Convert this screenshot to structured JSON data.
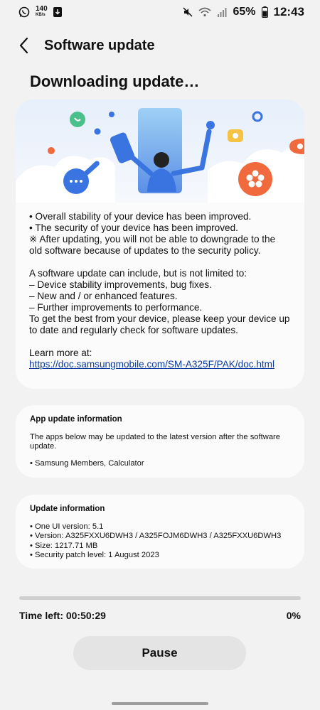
{
  "status": {
    "speed_value": "140",
    "speed_unit": "KB/s",
    "battery": "65%",
    "time": "12:43",
    "icons": [
      "whatsapp-icon",
      "download-icon",
      "mute-icon",
      "wifi-icon",
      "signal-icon",
      "battery-icon"
    ]
  },
  "appbar": {
    "title": "Software update"
  },
  "main": {
    "heading": "Downloading update…",
    "notes": [
      "• Overall stability of your device has been improved.",
      "• The security of your device has been improved.",
      "※ After updating, you will not be able to downgrade to the old software because of updates to the security policy."
    ],
    "includes_intro": "A software update can include, but is not limited to:",
    "includes": [
      " – Device stability improvements, bug fixes.",
      " – New and / or enhanced features.",
      " – Further improvements to performance."
    ],
    "keep_updated": "To get the best from your device, please keep your device up to date and regularly check for software updates.",
    "learn_more_label": "Learn more at:",
    "learn_more_link": "https://doc.samsungmobile.com/SM-A325F/PAK/doc.html"
  },
  "app_update": {
    "title": "App update information",
    "desc": "The apps below may be updated to the latest version after the software update.",
    "apps": "• Samsung Members, Calculator"
  },
  "update_info": {
    "title": "Update information",
    "lines": [
      "• One UI version: 5.1",
      "• Version: A325FXXU6DWH3 / A325FOJM6DWH3 / A325FXXU6DWH3",
      "• Size: 1217.71 MB",
      "• Security patch level: 1 August 2023"
    ]
  },
  "progress": {
    "fraction": 0.0,
    "time_left": "Time left: 00:50:29",
    "percent": "0%"
  },
  "actions": {
    "pause_label": "Pause"
  },
  "colors": {
    "link": "#0b3a9e",
    "accent_blue": "#3a74e0",
    "orange": "#f06a3e",
    "green": "#4cc08a"
  }
}
